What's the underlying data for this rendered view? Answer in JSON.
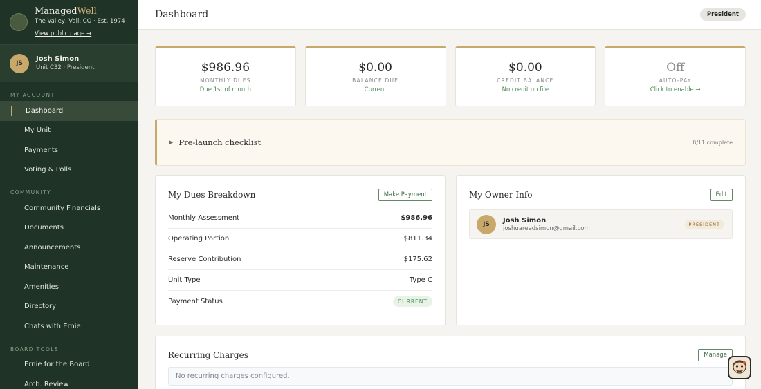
{
  "brand": {
    "name_part1": "Managed",
    "name_part2": "Well",
    "subtitle": "The Valley, Vail, CO · Est. 1974",
    "public_link": "View public page →"
  },
  "user": {
    "initials": "JS",
    "name": "Josh Simon",
    "subtitle": "Unit C32 · President"
  },
  "sidebar": {
    "sections": [
      {
        "label": "MY ACCOUNT",
        "items": [
          {
            "label": "Dashboard",
            "active": true
          },
          {
            "label": "My Unit"
          },
          {
            "label": "Payments"
          },
          {
            "label": "Voting & Polls"
          }
        ]
      },
      {
        "label": "COMMUNITY",
        "items": [
          {
            "label": "Community Financials"
          },
          {
            "label": "Documents"
          },
          {
            "label": "Announcements"
          },
          {
            "label": "Maintenance"
          },
          {
            "label": "Amenities"
          },
          {
            "label": "Directory"
          },
          {
            "label": "Chats with Ernie"
          }
        ]
      },
      {
        "label": "BOARD TOOLS",
        "items": [
          {
            "label": "Ernie for the Board"
          },
          {
            "label": "Arch. Review"
          }
        ]
      }
    ]
  },
  "header": {
    "title": "Dashboard",
    "role_badge": "President"
  },
  "stats": [
    {
      "value": "$986.96",
      "label": "MONTHLY DUES",
      "sub": "Due 1st of month"
    },
    {
      "value": "$0.00",
      "label": "BALANCE DUE",
      "sub": "Current"
    },
    {
      "value": "$0.00",
      "label": "CREDIT BALANCE",
      "sub": "No credit on file"
    },
    {
      "value": "Off",
      "label": "AUTO-PAY",
      "sub": "Click to enable →"
    }
  ],
  "checklist": {
    "title": "Pre-launch checklist",
    "count": "8/11 complete"
  },
  "dues": {
    "title": "My Dues Breakdown",
    "button": "Make Payment",
    "rows": [
      {
        "label": "Monthly Assessment",
        "value": "$986.96"
      },
      {
        "label": "Operating Portion",
        "value": "$811.34"
      },
      {
        "label": "Reserve Contribution",
        "value": "$175.62"
      },
      {
        "label": "Unit Type",
        "value": "Type C"
      },
      {
        "label": "Payment Status",
        "value": "CURRENT"
      }
    ]
  },
  "owner": {
    "title": "My Owner Info",
    "button": "Edit",
    "initials": "JS",
    "name": "Josh Simon",
    "email": "joshuareedsimon@gmail.com",
    "role": "PRESIDENT"
  },
  "recurring": {
    "title": "Recurring Charges",
    "button": "Manage",
    "empty": "No recurring charges configured."
  },
  "icons": {
    "brand_logo": "brand-logo-icon",
    "checklist_caret": "caret-right-icon",
    "chat": "chat-assistant-icon"
  },
  "colors": {
    "sidebar_bg": "#1f3326",
    "accent_gold": "#c9a86c",
    "success_green": "#4f8a55"
  }
}
